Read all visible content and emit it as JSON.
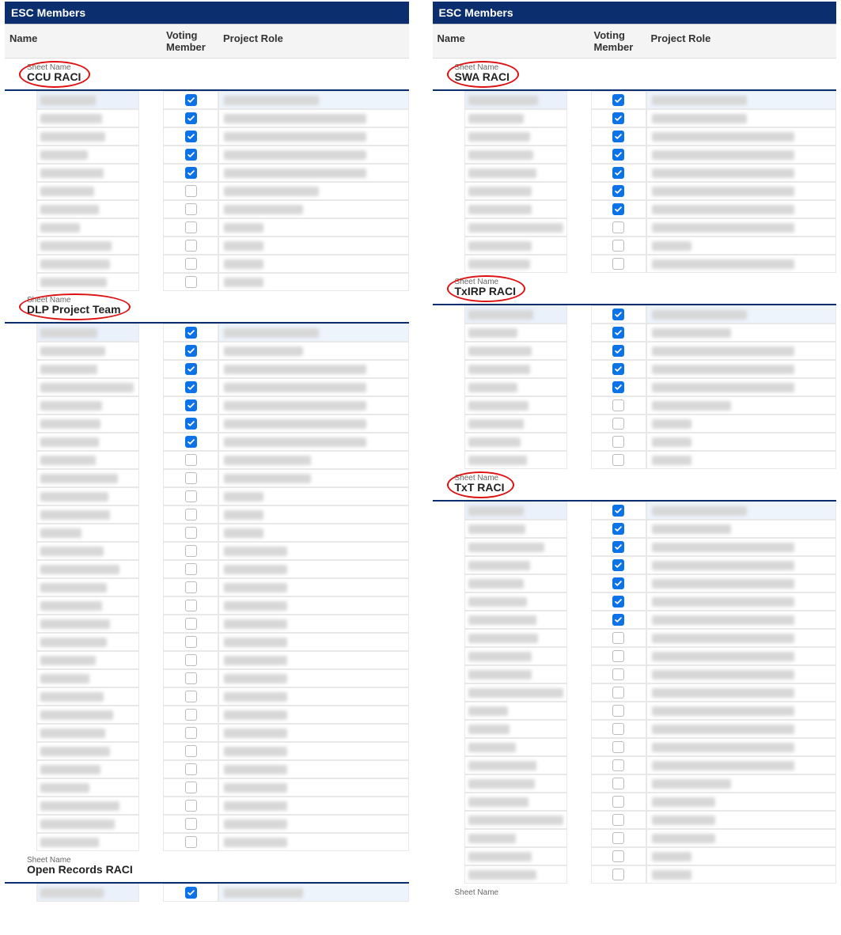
{
  "panels": {
    "left": {
      "title": "ESC Members",
      "columns": {
        "name": "Name",
        "voting": "Voting Member",
        "role": "Project Role"
      },
      "sheet_label": "Sheet Name",
      "sheets": [
        {
          "name": "CCU RACI",
          "circled": true,
          "rows": [
            {
              "name_w": 70,
              "voting": true,
              "role_w": 120,
              "hl": true
            },
            {
              "name_w": 78,
              "voting": true,
              "role_w": 180
            },
            {
              "name_w": 82,
              "voting": true,
              "role_w": 180
            },
            {
              "name_w": 60,
              "voting": true,
              "role_w": 180
            },
            {
              "name_w": 80,
              "voting": true,
              "role_w": 180
            },
            {
              "name_w": 68,
              "voting": false,
              "role_w": 120
            },
            {
              "name_w": 74,
              "voting": false,
              "role_w": 100
            },
            {
              "name_w": 50,
              "voting": false,
              "role_w": 50
            },
            {
              "name_w": 90,
              "voting": false,
              "role_w": 50
            },
            {
              "name_w": 88,
              "voting": false,
              "role_w": 50
            },
            {
              "name_w": 84,
              "voting": false,
              "role_w": 50
            }
          ]
        },
        {
          "name": "DLP Project Team",
          "circled": true,
          "rows": [
            {
              "name_w": 72,
              "voting": true,
              "role_w": 120,
              "hl": true
            },
            {
              "name_w": 82,
              "voting": true,
              "role_w": 100
            },
            {
              "name_w": 72,
              "voting": true,
              "role_w": 180
            },
            {
              "name_w": 118,
              "voting": true,
              "role_w": 180
            },
            {
              "name_w": 78,
              "voting": true,
              "role_w": 180
            },
            {
              "name_w": 76,
              "voting": true,
              "role_w": 180
            },
            {
              "name_w": 74,
              "voting": true,
              "role_w": 180
            },
            {
              "name_w": 70,
              "voting": false,
              "role_w": 110
            },
            {
              "name_w": 98,
              "voting": false,
              "role_w": 110
            },
            {
              "name_w": 86,
              "voting": false,
              "role_w": 50
            },
            {
              "name_w": 88,
              "voting": false,
              "role_w": 50
            },
            {
              "name_w": 52,
              "voting": false,
              "role_w": 50
            },
            {
              "name_w": 80,
              "voting": false,
              "role_w": 80
            },
            {
              "name_w": 100,
              "voting": false,
              "role_w": 80
            },
            {
              "name_w": 84,
              "voting": false,
              "role_w": 80
            },
            {
              "name_w": 78,
              "voting": false,
              "role_w": 80
            },
            {
              "name_w": 88,
              "voting": false,
              "role_w": 80
            },
            {
              "name_w": 84,
              "voting": false,
              "role_w": 80
            },
            {
              "name_w": 70,
              "voting": false,
              "role_w": 80
            },
            {
              "name_w": 62,
              "voting": false,
              "role_w": 80
            },
            {
              "name_w": 80,
              "voting": false,
              "role_w": 80
            },
            {
              "name_w": 92,
              "voting": false,
              "role_w": 80
            },
            {
              "name_w": 82,
              "voting": false,
              "role_w": 80
            },
            {
              "name_w": 88,
              "voting": false,
              "role_w": 80
            },
            {
              "name_w": 76,
              "voting": false,
              "role_w": 80
            },
            {
              "name_w": 62,
              "voting": false,
              "role_w": 80
            },
            {
              "name_w": 100,
              "voting": false,
              "role_w": 80
            },
            {
              "name_w": 94,
              "voting": false,
              "role_w": 80
            },
            {
              "name_w": 74,
              "voting": false,
              "role_w": 80
            }
          ]
        },
        {
          "name": "Open Records RACI",
          "circled": false,
          "rows": [
            {
              "name_w": 80,
              "voting": true,
              "role_w": 100,
              "hl": true
            }
          ]
        }
      ]
    },
    "right": {
      "title": "ESC Members",
      "columns": {
        "name": "Name",
        "voting": "Voting Member",
        "role": "Project Role"
      },
      "sheet_label": "Sheet Name",
      "sheets": [
        {
          "name": "SWA RACI",
          "circled": true,
          "rows": [
            {
              "name_w": 88,
              "voting": true,
              "role_w": 120,
              "hl": true
            },
            {
              "name_w": 70,
              "voting": true,
              "role_w": 120
            },
            {
              "name_w": 78,
              "voting": true,
              "role_w": 180
            },
            {
              "name_w": 82,
              "voting": true,
              "role_w": 180
            },
            {
              "name_w": 86,
              "voting": true,
              "role_w": 180
            },
            {
              "name_w": 80,
              "voting": true,
              "role_w": 180
            },
            {
              "name_w": 80,
              "voting": true,
              "role_w": 180
            },
            {
              "name_w": 150,
              "voting": false,
              "role_w": 180
            },
            {
              "name_w": 80,
              "voting": false,
              "role_w": 50
            },
            {
              "name_w": 78,
              "voting": false,
              "role_w": 180
            }
          ]
        },
        {
          "name": "TxIRP RACI",
          "circled": true,
          "rows": [
            {
              "name_w": 82,
              "voting": true,
              "role_w": 120,
              "hl": true
            },
            {
              "name_w": 62,
              "voting": true,
              "role_w": 100
            },
            {
              "name_w": 80,
              "voting": true,
              "role_w": 180
            },
            {
              "name_w": 78,
              "voting": true,
              "role_w": 180
            },
            {
              "name_w": 62,
              "voting": true,
              "role_w": 180
            },
            {
              "name_w": 76,
              "voting": false,
              "role_w": 100
            },
            {
              "name_w": 70,
              "voting": false,
              "role_w": 50
            },
            {
              "name_w": 66,
              "voting": false,
              "role_w": 50
            },
            {
              "name_w": 74,
              "voting": false,
              "role_w": 50
            }
          ]
        },
        {
          "name": "TxT RACI",
          "circled": true,
          "rows": [
            {
              "name_w": 70,
              "voting": true,
              "role_w": 120,
              "hl": true
            },
            {
              "name_w": 72,
              "voting": true,
              "role_w": 100
            },
            {
              "name_w": 96,
              "voting": true,
              "role_w": 180
            },
            {
              "name_w": 78,
              "voting": true,
              "role_w": 180
            },
            {
              "name_w": 70,
              "voting": true,
              "role_w": 180
            },
            {
              "name_w": 74,
              "voting": true,
              "role_w": 180
            },
            {
              "name_w": 86,
              "voting": true,
              "role_w": 180
            },
            {
              "name_w": 88,
              "voting": false,
              "role_w": 180
            },
            {
              "name_w": 80,
              "voting": false,
              "role_w": 180
            },
            {
              "name_w": 80,
              "voting": false,
              "role_w": 180
            },
            {
              "name_w": 160,
              "voting": false,
              "role_w": 180
            },
            {
              "name_w": 50,
              "voting": false,
              "role_w": 180
            },
            {
              "name_w": 52,
              "voting": false,
              "role_w": 180
            },
            {
              "name_w": 60,
              "voting": false,
              "role_w": 180
            },
            {
              "name_w": 86,
              "voting": false,
              "role_w": 180
            },
            {
              "name_w": 84,
              "voting": false,
              "role_w": 100
            },
            {
              "name_w": 76,
              "voting": false,
              "role_w": 80
            },
            {
              "name_w": 130,
              "voting": false,
              "role_w": 80
            },
            {
              "name_w": 60,
              "voting": false,
              "role_w": 80
            },
            {
              "name_w": 80,
              "voting": false,
              "role_w": 50
            },
            {
              "name_w": 86,
              "voting": false,
              "role_w": 50
            }
          ]
        },
        {
          "name": "",
          "label_only": true,
          "circled": false,
          "rows": []
        }
      ]
    }
  }
}
